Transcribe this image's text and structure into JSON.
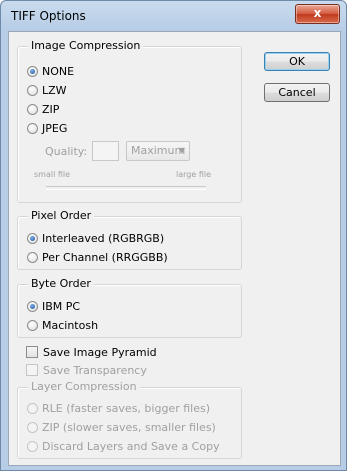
{
  "window": {
    "title": "TIFF Options",
    "close_label": "x"
  },
  "buttons": {
    "ok_label": "OK",
    "cancel_label": "Cancel"
  },
  "image_compression": {
    "legend": "Image Compression",
    "options": [
      "NONE",
      "LZW",
      "ZIP",
      "JPEG"
    ],
    "selected": "NONE",
    "quality_label": "Quality:",
    "quality_value": "",
    "quality_select": "Maximum",
    "small_file_label": "small file",
    "large_file_label": "large file"
  },
  "pixel_order": {
    "legend": "Pixel Order",
    "options": [
      "Interleaved (RGBRGB)",
      "Per Channel (RRGGBB)"
    ],
    "selected": "Interleaved (RGBRGB)"
  },
  "byte_order": {
    "legend": "Byte Order",
    "options": [
      "IBM PC",
      "Macintosh"
    ],
    "selected": "IBM PC"
  },
  "checkboxes": {
    "save_image_pyramid": "Save Image Pyramid",
    "save_transparency": "Save Transparency"
  },
  "layer_compression": {
    "legend": "Layer Compression",
    "options": [
      "RLE (faster saves, bigger files)",
      "ZIP (slower saves, smaller files)",
      "Discard Layers and Save a Copy"
    ]
  }
}
